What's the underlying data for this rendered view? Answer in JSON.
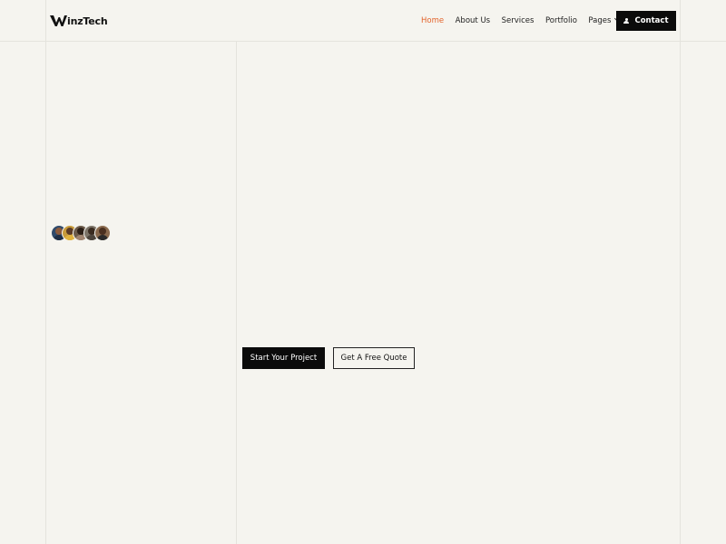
{
  "brand": {
    "name": "inzTech",
    "logo_icon": "w-logo-icon"
  },
  "nav": {
    "items": [
      {
        "label": "Home",
        "active": true
      },
      {
        "label": "About Us",
        "active": false
      },
      {
        "label": "Services",
        "active": false
      },
      {
        "label": "Portfolio",
        "active": false
      },
      {
        "label": "Pages",
        "active": false,
        "has_dropdown": true
      }
    ],
    "contact_label": "Contact",
    "contact_icon": "user-icon"
  },
  "hero": {
    "avatars_count": 5,
    "primary_cta": "Start Your Project",
    "secondary_cta": "Get A Free Quote"
  },
  "colors": {
    "background": "#f5f4ef",
    "accent": "#e3642c",
    "dark": "#0b0b0b"
  }
}
